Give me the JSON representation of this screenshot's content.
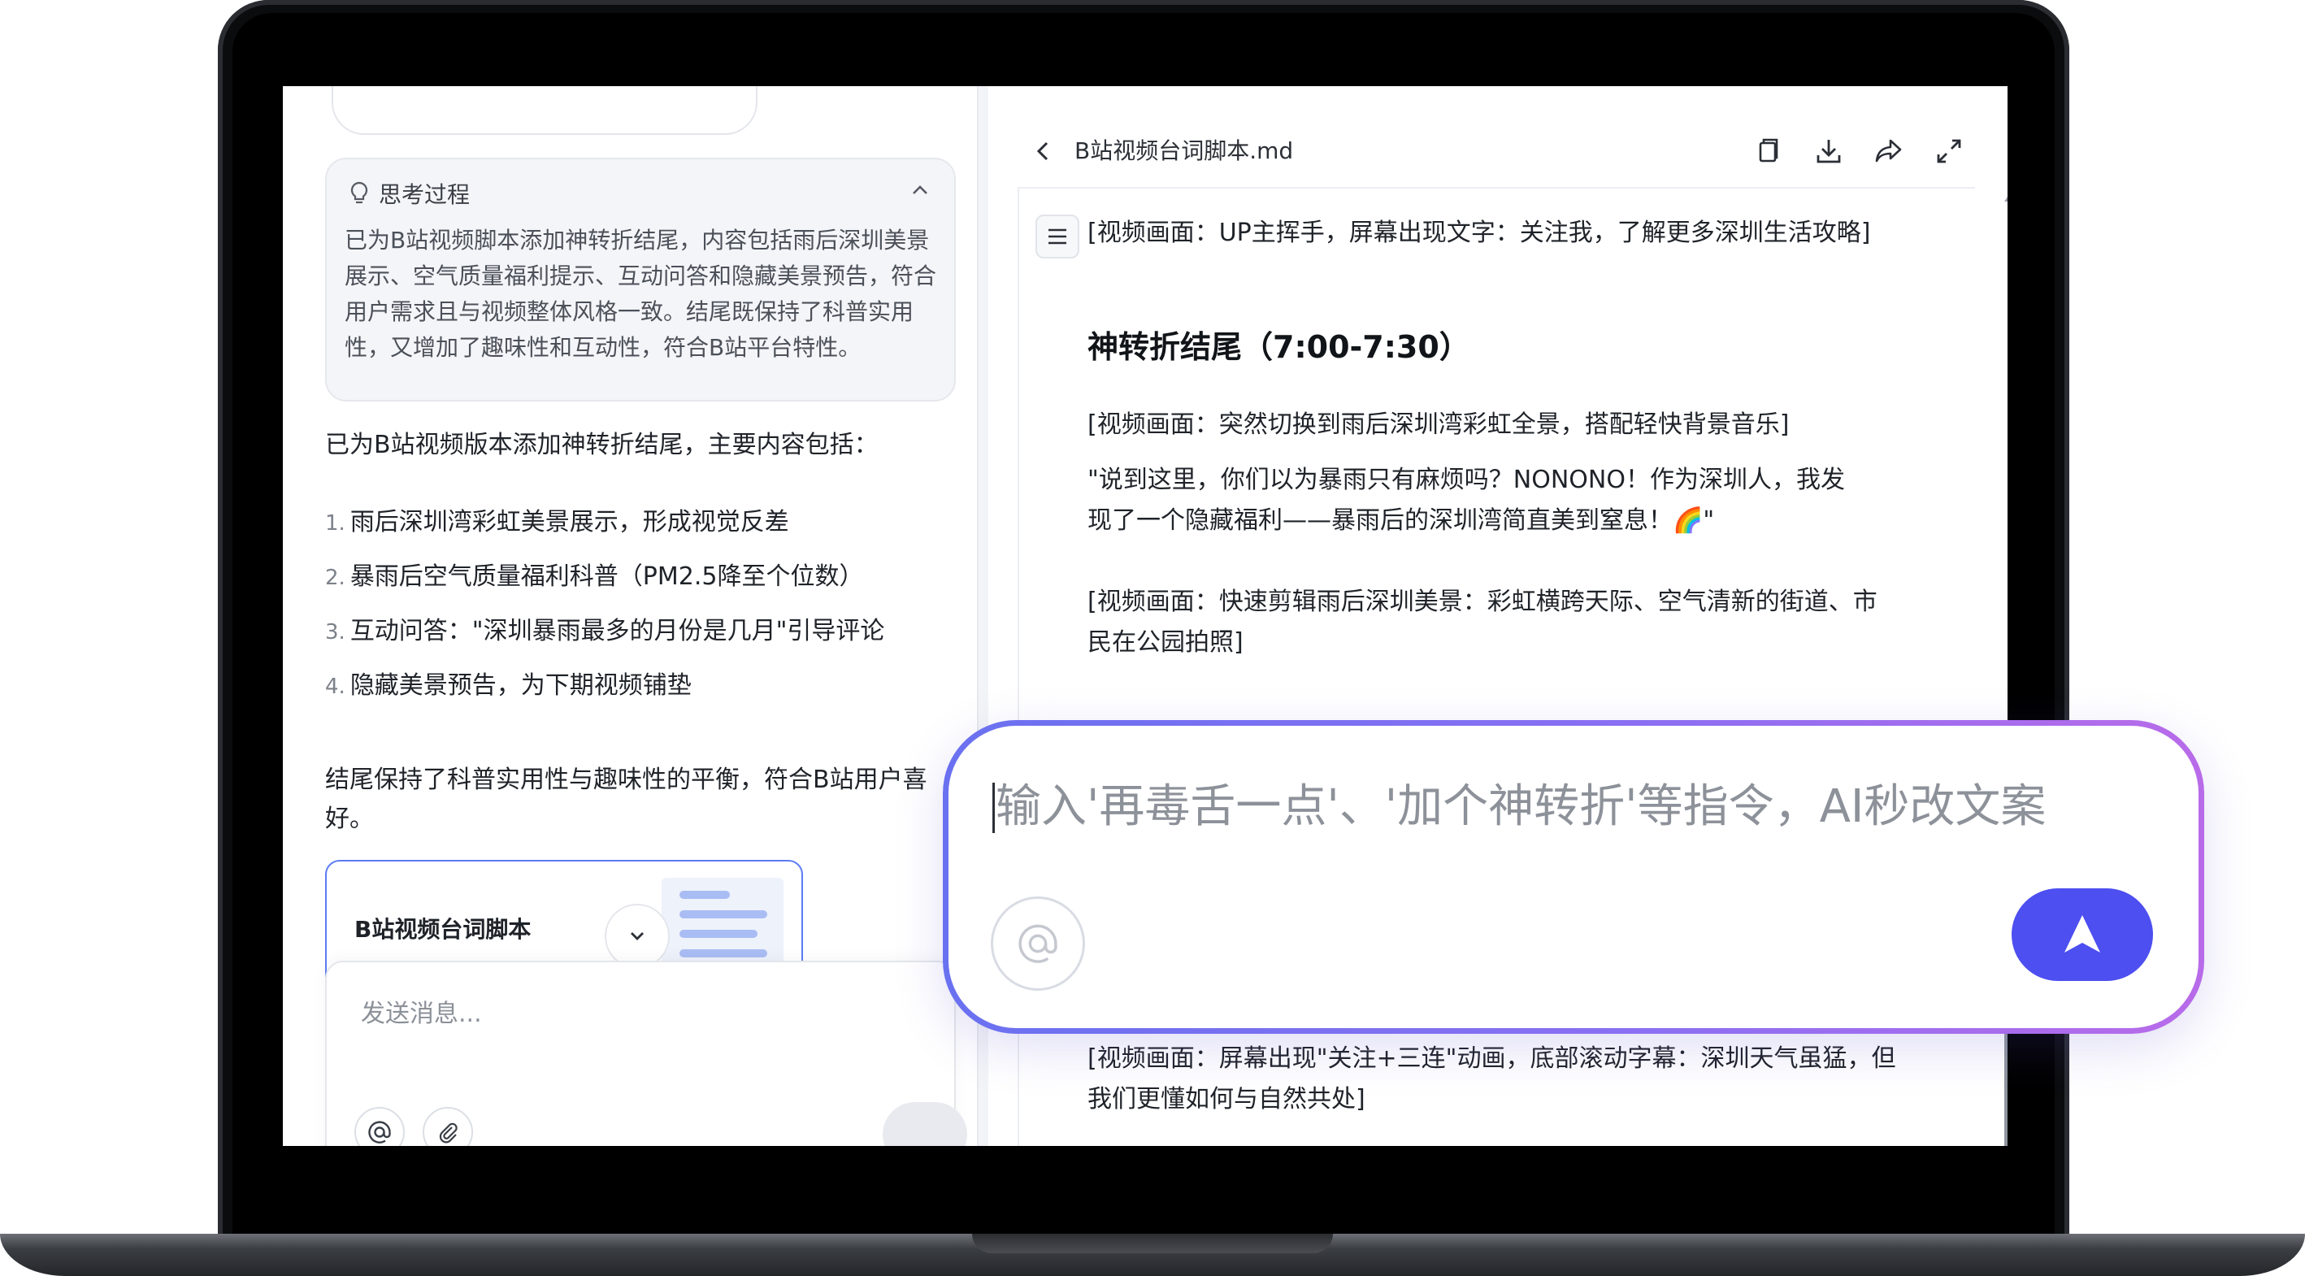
{
  "left_panel": {
    "thinking": {
      "title": "思考过程",
      "body": "已为B站视频脚本添加神转折结尾，内容包括雨后深圳美景展示、空气质量福利提示、互动问答和隐藏美景预告，符合用户需求且与视频整体风格一致。结尾既保持了科普实用性，又增加了趣味性和互动性，符合B站平台特性。"
    },
    "intro": "已为B站视频版本添加神转折结尾，主要内容包括：",
    "list": [
      {
        "num": "1.",
        "text": "雨后深圳湾彩虹美景展示，形成视觉反差"
      },
      {
        "num": "2.",
        "text": "暴雨后空气质量福利科普（PM2.5降至个位数）"
      },
      {
        "num": "3.",
        "text": "互动问答：\"深圳暴雨最多的月份是几月\"引导评论"
      },
      {
        "num": "4.",
        "text": "隐藏美景预告，为下期视频铺垫"
      }
    ],
    "summary": "结尾保持了科普实用性与趣味性的平衡，符合B站用户喜好。",
    "doc_card_title": "B站视频台词脚本",
    "input_placeholder": "发送消息..."
  },
  "right_panel": {
    "filename": "B站视频台词脚本.md",
    "p1": "[视频画面：UP主挥手，屏幕出现文字：关注我，了解更多深圳生活攻略]",
    "heading": "神转折结尾（7:00-7:30）",
    "p2": "[视频画面：突然切换到雨后深圳湾彩虹全景，搭配轻快背景音乐]",
    "p3": "\"说到这里，你们以为暴雨只有麻烦吗？NONONO！作为深圳人，我发现了一个隐藏福利——暴雨后的深圳湾简直美到窒息！🌈\"",
    "p4": "[视频画面：快速剪辑雨后深圳美景：彩虹横跨天际、空气清新的街道、市民在公园拍照]",
    "p5": "[视频画面：屏幕出现\"关注+三连\"动画，底部滚动字幕：深圳天气虽猛，但我们更懂如何与自然共处]"
  },
  "ai_box": {
    "placeholder": "输入'再毒舌一点'、'加个神转折'等指令，AI秒改文案"
  },
  "colors": {
    "accent": "#4d4ff0",
    "border_gradient": [
      "#6a71f0",
      "#b86be9"
    ],
    "card_border": "#5b7cf3"
  }
}
